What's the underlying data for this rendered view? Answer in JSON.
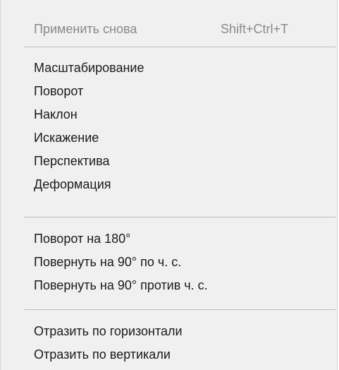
{
  "menu": {
    "reapply": {
      "label": "Применить снова",
      "shortcut": "Shift+Ctrl+T"
    },
    "group1": {
      "scale": "Масштабирование",
      "rotate": "Поворот",
      "skew": "Наклон",
      "distort": "Искажение",
      "perspective": "Перспектива",
      "warp": "Деформация"
    },
    "group2": {
      "rotate180": "Поворот на 180°",
      "rotate90cw": "Повернуть на 90° по ч. с.",
      "rotate90ccw": "Повернуть на 90° против ч. с."
    },
    "group3": {
      "flip_h": "Отразить по горизонтали",
      "flip_v": "Отразить по вертикали"
    }
  }
}
